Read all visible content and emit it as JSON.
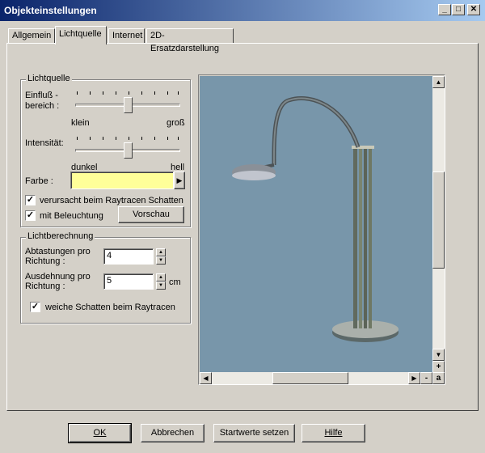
{
  "window": {
    "title": "Objekteinstellungen"
  },
  "titlebar_buttons": {
    "minimize": "_",
    "maximize": "□",
    "close": "✕"
  },
  "tabs": [
    {
      "label": "Allgemein"
    },
    {
      "label": "Lichtquelle"
    },
    {
      "label": "Internet"
    },
    {
      "label": "2D-Ersatzdarstellung"
    }
  ],
  "lichtquelle": {
    "group_label": "Lichtquelle",
    "einfluss_label": "Einfluß -\nbereich :",
    "einfluss_min": "klein",
    "einfluss_max": "groß",
    "einfluss_value": 0.5,
    "intensitaet_label": "Intensität:",
    "intensitaet_min": "dunkel",
    "intensitaet_max": "hell",
    "intensitaet_value": 0.5,
    "farbe_label": "Farbe :",
    "farbe_color": "#ffff99",
    "schatten_label": "verursacht beim Raytracen Schatten",
    "schatten_checked": "✓",
    "beleuchtung_label": "mit Beleuchtung",
    "beleuchtung_checked": "✓",
    "vorschau_label": "Vorschau"
  },
  "lichtberechnung": {
    "group_label": "Lichtberechnung",
    "abtastungen_label": "Abtastungen pro\nRichtung :",
    "abtastungen_value": "4",
    "ausdehnung_label": "Ausdehnung pro\nRichtung :",
    "ausdehnung_value": "5",
    "ausdehnung_unit": "cm",
    "weiche_label": "weiche Schatten beim Raytracen",
    "weiche_checked": "✓"
  },
  "preview": {
    "background": "#7896aa",
    "zoom_plus": "+",
    "zoom_minus": "-",
    "zoom_a": "a"
  },
  "footer": {
    "ok": "OK",
    "abbrechen": "Abbrechen",
    "startwerte": "Startwerte setzen",
    "hilfe": "Hilfe"
  }
}
